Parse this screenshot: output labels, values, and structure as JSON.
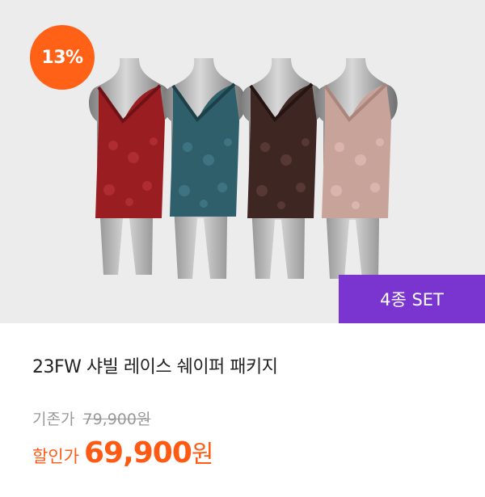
{
  "badge": {
    "discount": "13%",
    "set": "4종 SET"
  },
  "product": {
    "title": "23FW 샤빌 레이스 쉐이퍼 패키지",
    "original_label": "기존가",
    "original_price": "79,900원",
    "sale_label": "할인가",
    "sale_price": "69,900",
    "sale_currency": "원"
  },
  "colors": {
    "badge_orange": "#ff6117",
    "set_purple": "#7a34cf",
    "price_orange": "#ff5a14",
    "variants": [
      "#9a1d22",
      "#2f5f6b",
      "#3e2623",
      "#c8a39a"
    ]
  },
  "image": {
    "description_icon": "mannequin-product-image"
  }
}
